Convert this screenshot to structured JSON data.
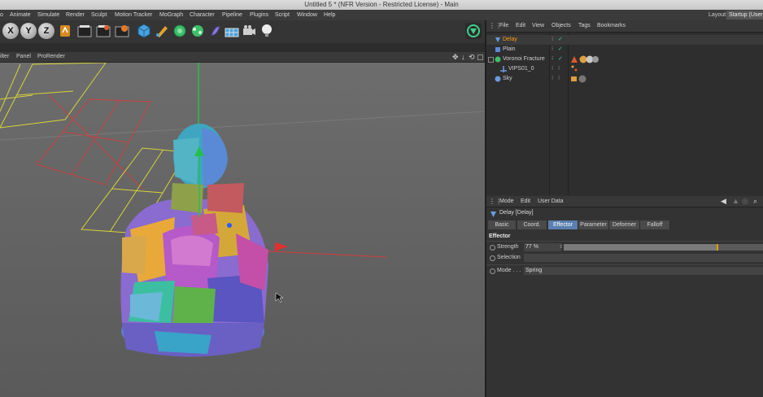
{
  "window": {
    "title": "Untitled 5 * (NFR Version - Restricted License) - Main"
  },
  "menubar": {
    "items": [
      "o",
      "Animate",
      "Simulate",
      "Render",
      "Sculpt",
      "Motion Tracker",
      "MoGraph",
      "Character",
      "Pipeline",
      "Plugins",
      "Script",
      "Window",
      "Help"
    ],
    "layout_label": "Layout:",
    "layout_value": "Startup (User)"
  },
  "toolbar": {
    "x_label": "X",
    "y_label": "Y",
    "z_label": "Z"
  },
  "viewport": {
    "menu": [
      "ilter",
      "Panel",
      "ProRender"
    ]
  },
  "object_manager": {
    "menu": [
      "File",
      "Edit",
      "View",
      "Objects",
      "Tags",
      "Bookmarks"
    ],
    "objects": [
      {
        "name": "Delay",
        "selected": true,
        "color": "#ff9f1a"
      },
      {
        "name": "Plain",
        "selected": false,
        "color": "#d4d4d4"
      },
      {
        "name": "Voronoi Fracture",
        "selected": false,
        "color": "#d4d4d4"
      },
      {
        "name": "VIPS01_0",
        "selected": false,
        "color": "#d4d4d4"
      },
      {
        "name": "Sky",
        "selected": false,
        "color": "#d4d4d4"
      }
    ]
  },
  "attribute_manager": {
    "menu": [
      "Mode",
      "Edit",
      "User Data"
    ],
    "title": "Delay [Delay]",
    "tabs": [
      "Basic",
      "Coord.",
      "Effector",
      "Parameter",
      "Deformer",
      "Falloff"
    ],
    "active_tab": "Effector",
    "section": "Effector",
    "strength_label": "Strength",
    "strength_value": "77 %",
    "strength_fraction": 0.77,
    "selection_label": "Selection",
    "selection_value": "",
    "mode_label": "Mode . . .",
    "mode_value": "Spring"
  },
  "colors": {
    "accent": "#5a7fb0",
    "selected_text": "#ff9f1a",
    "slider_marker": "#e0a000"
  }
}
